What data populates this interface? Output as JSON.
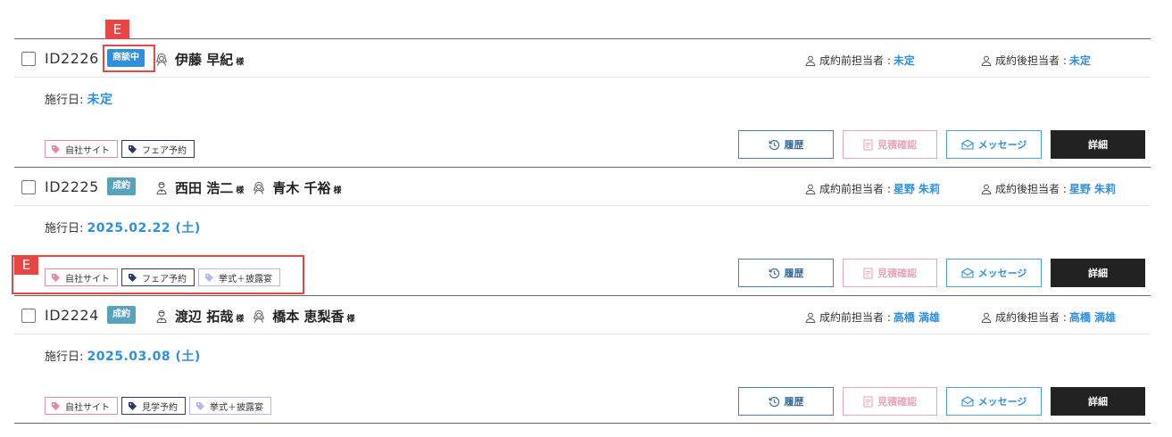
{
  "labels": {
    "staff_before": "成約前担当者 : ",
    "staff_after": "成約後担当者 : ",
    "sama": "様",
    "date_label": "施行日: ",
    "btn_history": "履歴",
    "btn_estimate": "見積確認",
    "btn_message": "メッセージ",
    "btn_detail": "詳細"
  },
  "annotation_marker": "E",
  "colors": {
    "accent": "#2f8fdc",
    "badge_negotiating": "#2f8fdc",
    "badge_contracted": "#57a3bd",
    "marker": "#e84545"
  },
  "records": [
    {
      "id": "ID2226",
      "status": "商談中",
      "persons": [
        {
          "icon": "bride-icon",
          "name": "伊藤 早紀"
        }
      ],
      "staff_before": "未定",
      "staff_after": "未定",
      "date": "未定",
      "tags": [
        {
          "label": "自社サイト",
          "style": "pink"
        },
        {
          "label": "フェア予約",
          "style": "navy"
        }
      ]
    },
    {
      "id": "ID2225",
      "status": "成約",
      "persons": [
        {
          "icon": "groom-icon",
          "name": "西田 浩二"
        },
        {
          "icon": "bride-icon",
          "name": "青木 千裕"
        }
      ],
      "staff_before": "星野 朱莉",
      "staff_after": "星野 朱莉",
      "date": "2025.02.22 (土)",
      "tags": [
        {
          "label": "自社サイト",
          "style": "pink"
        },
        {
          "label": "フェア予約",
          "style": "navy"
        },
        {
          "label": "挙式＋披露宴",
          "style": "lav"
        }
      ]
    },
    {
      "id": "ID2224",
      "status": "成約",
      "persons": [
        {
          "icon": "groom-icon",
          "name": "渡辺 拓哉"
        },
        {
          "icon": "bride-icon",
          "name": "橋本 恵梨香"
        }
      ],
      "staff_before": "高橋 満雄",
      "staff_after": "高橋 満雄",
      "date": "2025.03.08 (土)",
      "tags": [
        {
          "label": "自社サイト",
          "style": "pink"
        },
        {
          "label": "見学予約",
          "style": "navy"
        },
        {
          "label": "挙式＋披露宴",
          "style": "lav"
        }
      ]
    }
  ]
}
